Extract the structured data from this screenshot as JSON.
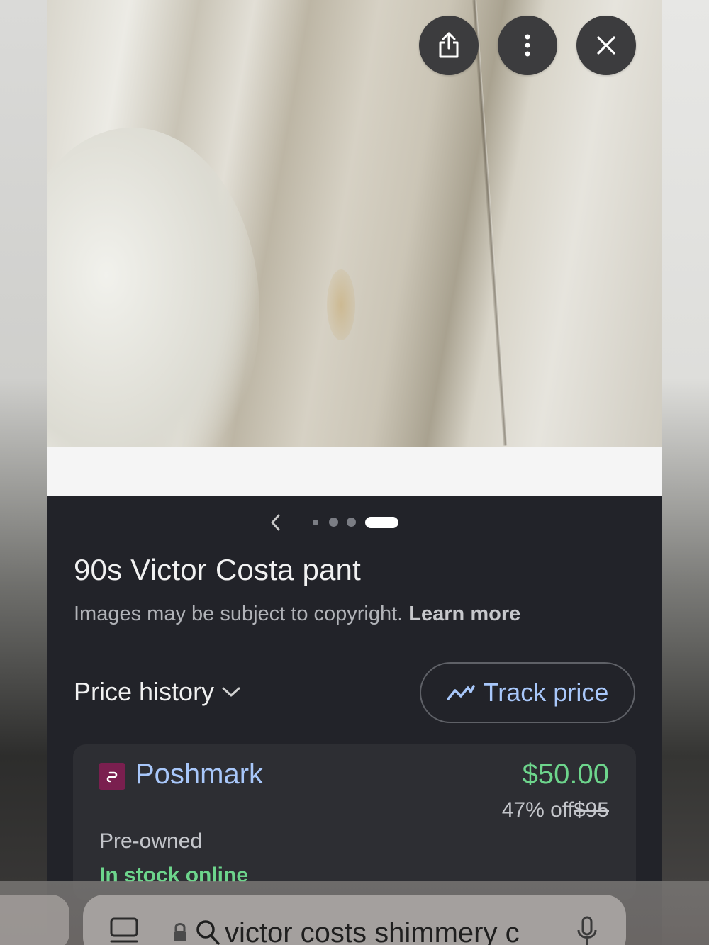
{
  "actions": {
    "share_icon": "share-icon",
    "more_icon": "more-vert-icon",
    "close_icon": "close-icon"
  },
  "pager": {
    "total": 4,
    "active_index": 4
  },
  "product": {
    "title": "90s Victor Costa pant",
    "copyright_text": "Images may be subject to copyright.",
    "learn_more": "Learn more"
  },
  "price_section": {
    "history_label": "Price history",
    "track_label": "Track price"
  },
  "offer": {
    "store": "Poshmark",
    "price": "$50.00",
    "discount": "47% off",
    "original_price": "$95",
    "condition": "Pre-owned",
    "availability": "In stock online"
  },
  "browser": {
    "url_text": "victor costs shimmery c"
  },
  "colors": {
    "panel_bg": "#222329",
    "card_bg": "#2d2e33",
    "link_blue": "#a8c7fa",
    "price_green": "#6dd58c"
  }
}
